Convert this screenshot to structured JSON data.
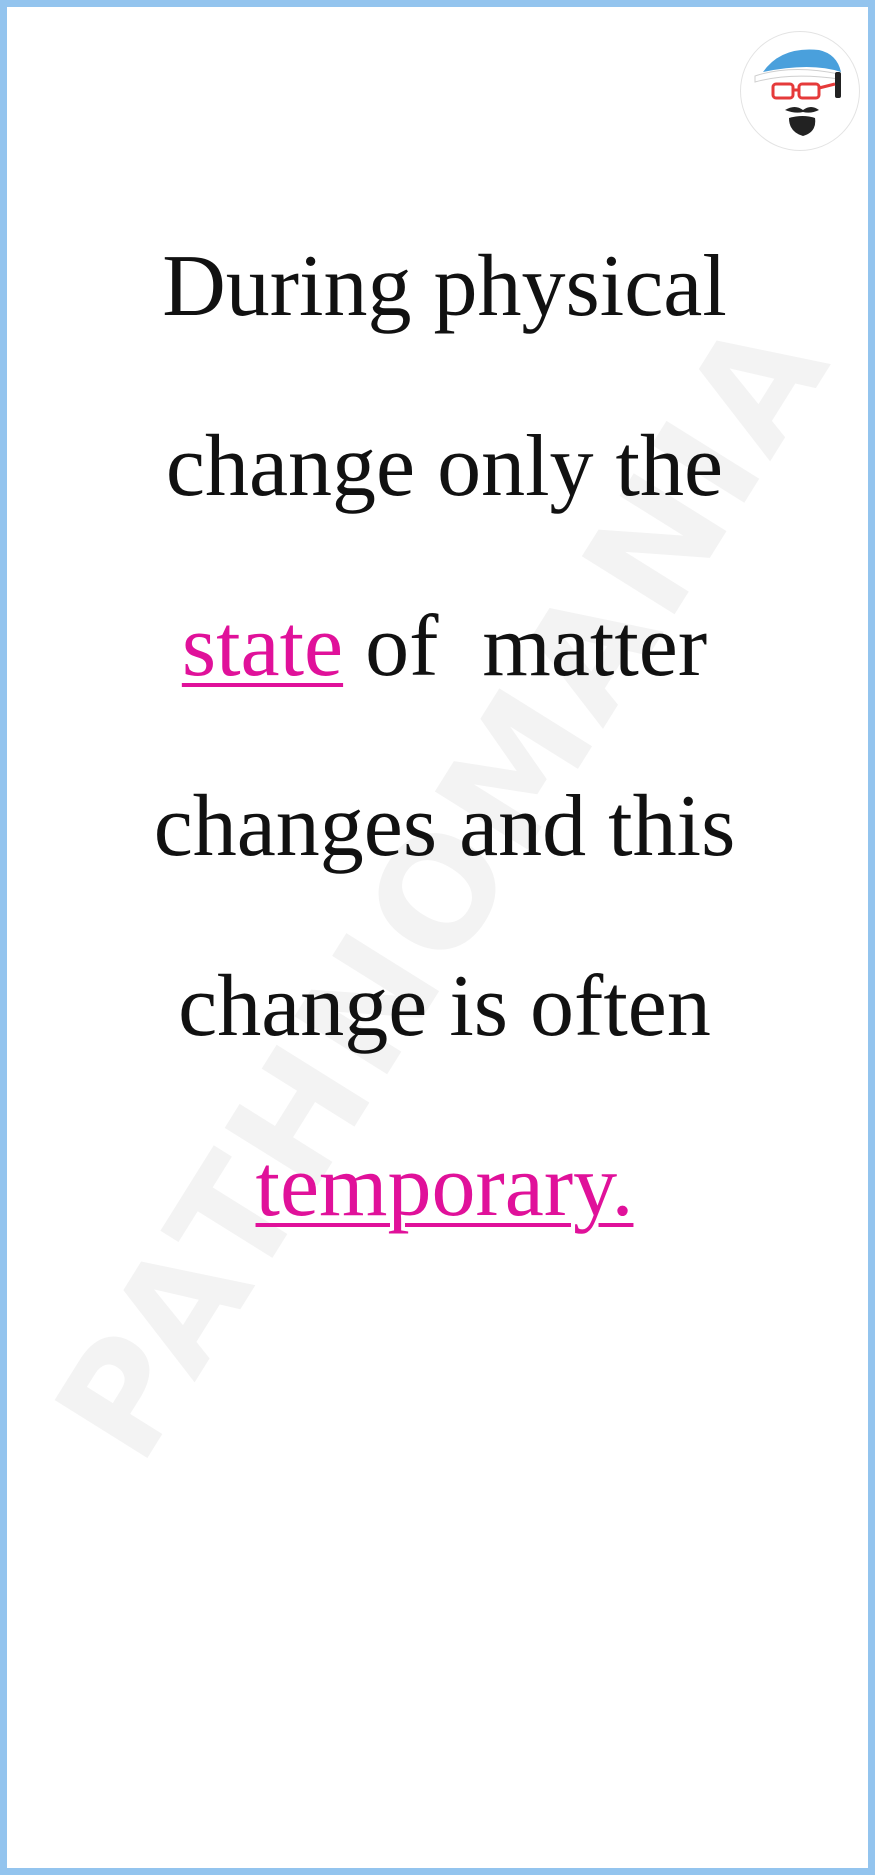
{
  "watermark": "PATHNOMANIA",
  "avatar": {
    "icon": "cartoon-face-logo-icon"
  },
  "statement": {
    "line1": "During physical",
    "line2": "change only the",
    "line3_highlight": "state",
    "line3_rest": " of  matter",
    "line4": "changes and this",
    "line5": "change is often",
    "line6_highlight": "temporary."
  },
  "colors": {
    "border": "#93c4ee",
    "text": "#111111",
    "highlight": "#e0119a",
    "watermark": "#f3f3f3"
  }
}
